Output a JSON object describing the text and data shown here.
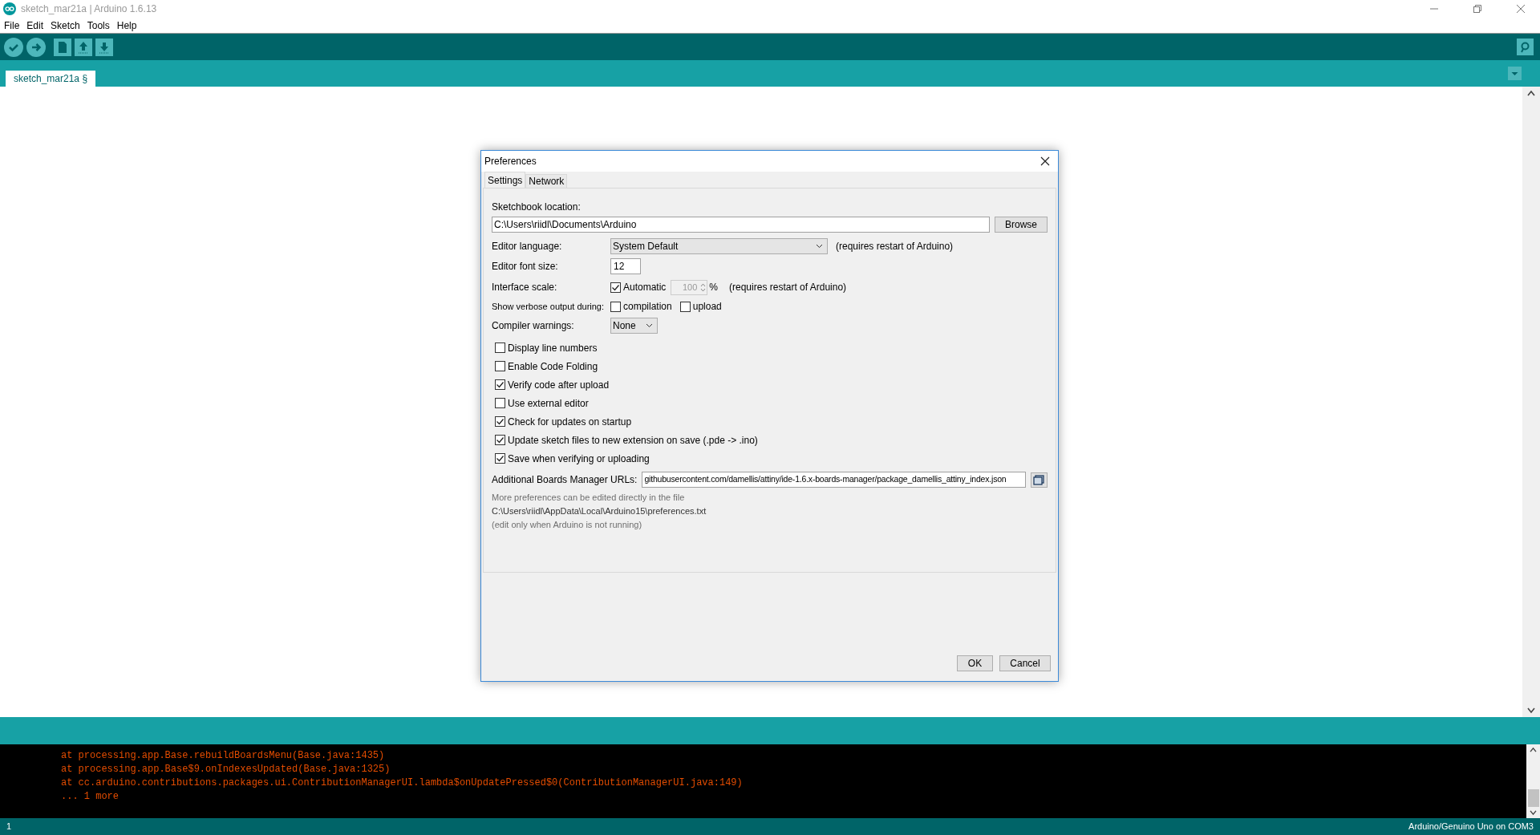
{
  "window": {
    "title": "sketch_mar21a | Arduino 1.6.13"
  },
  "menu": [
    "File",
    "Edit",
    "Sketch",
    "Tools",
    "Help"
  ],
  "editor_tabs": [
    {
      "label": "sketch_mar21a §",
      "selected": true
    }
  ],
  "preferences": {
    "title": "Preferences",
    "tabs": [
      {
        "label": "Settings",
        "selected": true
      },
      {
        "label": "Network",
        "selected": false
      }
    ],
    "sketchbook": {
      "label": "Sketchbook location:",
      "value": "C:\\Users\\riidl\\Documents\\Arduino",
      "button": "Browse"
    },
    "editor_language": {
      "label": "Editor language:",
      "value": "System Default",
      "note": "(requires restart of Arduino)"
    },
    "font_size": {
      "label": "Editor font size:",
      "value": "12"
    },
    "interface_scale": {
      "label": "Interface scale:",
      "automatic": {
        "label": "Automatic",
        "checked": true
      },
      "value": "100",
      "unit": "%",
      "note": "(requires restart of Arduino)"
    },
    "verbose": {
      "label": "Show verbose output during:",
      "options": [
        {
          "label": "compilation",
          "checked": false
        },
        {
          "label": "upload",
          "checked": false
        }
      ]
    },
    "compiler_warnings": {
      "label": "Compiler warnings:",
      "value": "None"
    },
    "options": [
      {
        "label": "Display line numbers",
        "checked": false
      },
      {
        "label": "Enable Code Folding",
        "checked": false
      },
      {
        "label": "Verify code after upload",
        "checked": true
      },
      {
        "label": "Use external editor",
        "checked": false
      },
      {
        "label": "Check for updates on startup",
        "checked": true
      },
      {
        "label": "Update sketch files to new extension on save (.pde -> .ino)",
        "checked": true
      },
      {
        "label": "Save when verifying or uploading",
        "checked": true
      }
    ],
    "boards_urls": {
      "label": "Additional Boards Manager URLs:",
      "value": "githubusercontent.com/damellis/attiny/ide-1.6.x-boards-manager/package_damellis_attiny_index.json"
    },
    "notes": [
      {
        "text": "More preferences can be edited directly in the file",
        "muted": true
      },
      {
        "text": "C:\\Users\\riidl\\AppData\\Local\\Arduino15\\preferences.txt",
        "muted": false
      },
      {
        "text": "(edit only when Arduino is not running)",
        "muted": true
      }
    ],
    "buttons": [
      "OK",
      "Cancel"
    ]
  },
  "console": {
    "lines": [
      "at processing.app.Base.rebuildBoardsMenu(Base.java:1435)",
      "at processing.app.Base$9.onIndexesUpdated(Base.java:1325)",
      "at cc.arduino.contributions.packages.ui.ContributionManagerUI.lambda$onUpdatePressed$0(ContributionManagerUI.java:149)",
      "... 1 more"
    ]
  },
  "status_bar": {
    "line": "1",
    "board": "Arduino/Genuino Uno on COM3"
  }
}
